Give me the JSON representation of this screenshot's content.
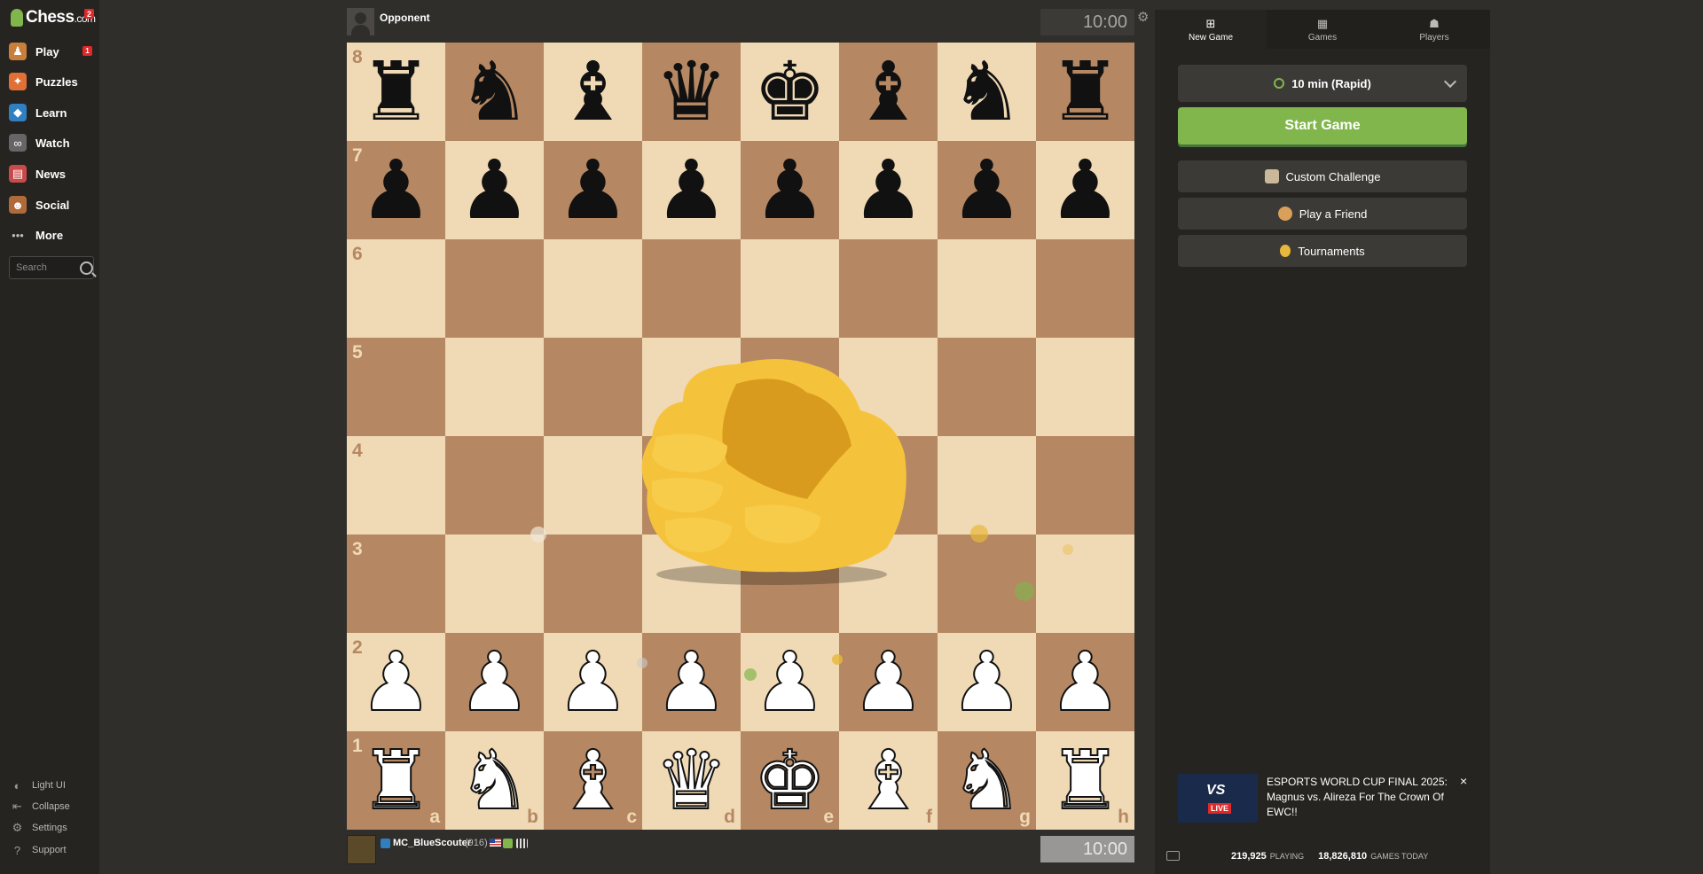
{
  "sidebar": {
    "logo_text": "Chess",
    "logo_suffix": ".com",
    "logo_badge": "2",
    "items": [
      {
        "label": "Play",
        "icon": "play-icon",
        "badge": "1"
      },
      {
        "label": "Puzzles",
        "icon": "puzzle-icon"
      },
      {
        "label": "Learn",
        "icon": "learn-icon"
      },
      {
        "label": "Watch",
        "icon": "binoculars-icon"
      },
      {
        "label": "News",
        "icon": "news-icon"
      },
      {
        "label": "Social",
        "icon": "social-icon"
      },
      {
        "label": "More",
        "icon": "more-icon"
      }
    ],
    "search_placeholder": "Search",
    "footer": [
      {
        "label": "Light UI",
        "icon": "light-ui-icon"
      },
      {
        "label": "Collapse",
        "icon": "collapse-icon"
      },
      {
        "label": "Settings",
        "icon": "gear-icon"
      },
      {
        "label": "Support",
        "icon": "help-icon"
      }
    ]
  },
  "opponent": {
    "name": "Opponent",
    "clock": "10:00"
  },
  "player": {
    "name": "MC_BlueScouter",
    "rating": "(916)",
    "clock": "10:00"
  },
  "board": {
    "ranks": [
      "8",
      "7",
      "6",
      "5",
      "4",
      "3",
      "2",
      "1"
    ],
    "files": [
      "a",
      "b",
      "c",
      "d",
      "e",
      "f",
      "g",
      "h"
    ],
    "rows": [
      [
        "r",
        "n",
        "b",
        "q",
        "k",
        "b",
        "n",
        "r"
      ],
      [
        "p",
        "p",
        "p",
        "p",
        "p",
        "p",
        "p",
        "p"
      ],
      [
        "",
        "",
        "",
        "",
        "",
        "",
        "",
        ""
      ],
      [
        "",
        "",
        "",
        "",
        "",
        "",
        "",
        ""
      ],
      [
        "",
        "",
        "",
        "",
        "",
        "",
        "",
        ""
      ],
      [
        "",
        "",
        "",
        "",
        "",
        "",
        "",
        ""
      ],
      [
        "P",
        "P",
        "P",
        "P",
        "P",
        "P",
        "P",
        "P"
      ],
      [
        "R",
        "N",
        "B",
        "Q",
        "K",
        "B",
        "N",
        "R"
      ]
    ]
  },
  "panel": {
    "tabs": [
      {
        "label": "New Game",
        "icon": "plus-square-icon"
      },
      {
        "label": "Games",
        "icon": "games-icon"
      },
      {
        "label": "Players",
        "icon": "players-icon"
      }
    ],
    "time_control": "10 min (Rapid)",
    "start_button": "Start Game",
    "options": [
      {
        "label": "Custom Challenge",
        "icon": "custom-challenge-icon"
      },
      {
        "label": "Play a Friend",
        "icon": "handshake-icon"
      },
      {
        "label": "Tournaments",
        "icon": "medal-icon"
      }
    ],
    "promo": {
      "title": "ESPORTS WORLD CUP FINAL 2025: Magnus vs. Alireza For The Crown Of EWC!!",
      "vs": "VS",
      "live": "LIVE",
      "close": "×"
    },
    "stats": {
      "playing_count": "219,925",
      "playing_label": "PLAYING",
      "games_count": "18,826,810",
      "games_label": "GAMES TODAY"
    }
  },
  "colors": {
    "accent": "#81b64c",
    "light_square": "#f0d9b5",
    "dark_square": "#b58863",
    "background": "#302e2b"
  }
}
